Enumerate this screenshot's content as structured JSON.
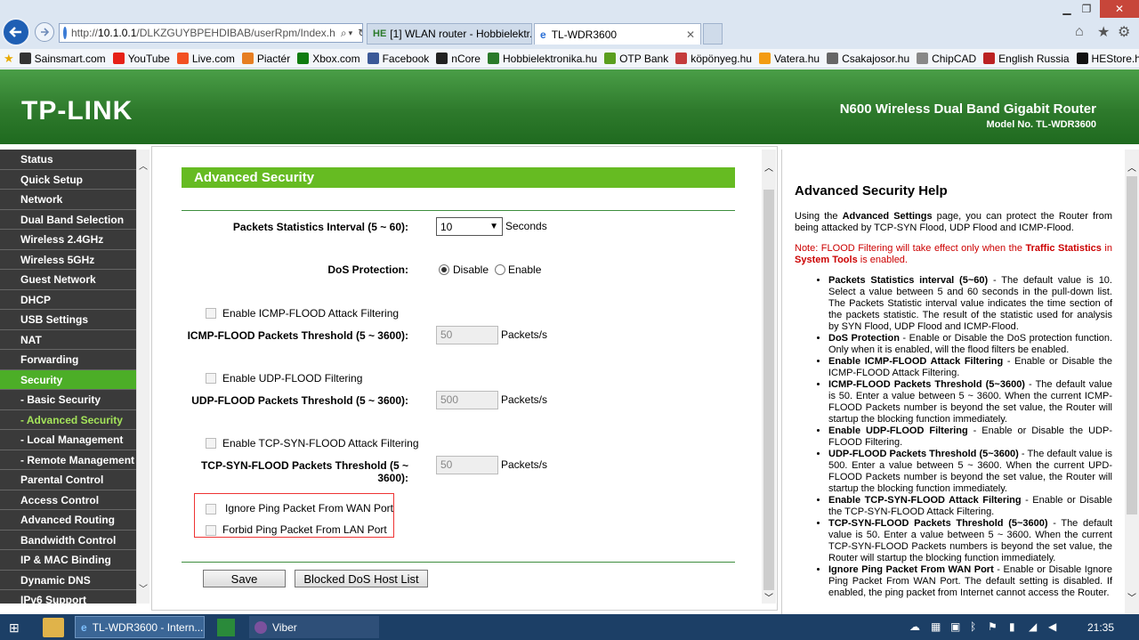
{
  "browser": {
    "address": {
      "prefix": "http://",
      "host": "10.1.0.1",
      "path": "/DLKZGUYBPEHDIBAB/userRpm/Index.h"
    },
    "tabs": [
      {
        "label": "[1] WLAN router - Hobbielektr...",
        "icon": "HE"
      },
      {
        "label": "TL-WDR3600",
        "icon": "e"
      }
    ],
    "favorites": [
      {
        "label": "Sainsmart.com",
        "color": "#333"
      },
      {
        "label": "YouTube",
        "color": "#e62117"
      },
      {
        "label": "Live.com",
        "color": "#f25022"
      },
      {
        "label": "Piactér",
        "color": "#e67e22"
      },
      {
        "label": "Xbox.com",
        "color": "#107c10"
      },
      {
        "label": "Facebook",
        "color": "#3b5998"
      },
      {
        "label": "nCore",
        "color": "#222"
      },
      {
        "label": "Hobbielektronika.hu",
        "color": "#2a7a2a"
      },
      {
        "label": "OTP Bank",
        "color": "#5a9e1e"
      },
      {
        "label": "köpönyeg.hu",
        "color": "#c43b3b"
      },
      {
        "label": "Vatera.hu",
        "color": "#f39c12"
      },
      {
        "label": "Csakajosor.hu",
        "color": "#666"
      },
      {
        "label": "ChipCAD",
        "color": "#888"
      },
      {
        "label": "English Russia",
        "color": "#b22"
      },
      {
        "label": "HEStore.hu",
        "color": "#111"
      }
    ]
  },
  "header": {
    "logo": "TP-LINK",
    "product": "N600 Wireless Dual Band Gigabit Router",
    "model": "Model No. TL-WDR3600"
  },
  "sidebar": {
    "items": [
      "Status",
      "Quick Setup",
      "Network",
      "Dual Band Selection",
      "Wireless 2.4GHz",
      "Wireless 5GHz",
      "Guest Network",
      "DHCP",
      "USB Settings",
      "NAT",
      "Forwarding",
      "Security",
      "- Basic Security",
      "- Advanced Security",
      "- Local Management",
      "- Remote Management",
      "Parental Control",
      "Access Control",
      "Advanced Routing",
      "Bandwidth Control",
      "IP & MAC Binding",
      "Dynamic DNS",
      "IPv6 Support"
    ]
  },
  "main": {
    "title": "Advanced Security",
    "interval_label": "Packets Statistics Interval (5 ~ 60):",
    "interval_value": "10",
    "seconds": "Seconds",
    "dos_label": "DoS Protection:",
    "disable": "Disable",
    "enable": "Enable",
    "icmp_filter": "Enable ICMP-FLOOD Attack Filtering",
    "icmp_threshold_label": "ICMP-FLOOD Packets Threshold (5 ~ 3600):",
    "icmp_threshold": "50",
    "udp_filter": "Enable UDP-FLOOD Filtering",
    "udp_threshold_label": "UDP-FLOOD Packets Threshold (5 ~ 3600):",
    "udp_threshold": "500",
    "tcp_filter": "Enable TCP-SYN-FLOOD Attack Filtering",
    "tcp_threshold_label": "TCP-SYN-FLOOD Packets Threshold (5 ~ 3600):",
    "tcp_threshold": "50",
    "unit": "Packets/s",
    "ignore_ping": "Ignore Ping Packet From WAN Port",
    "forbid_ping": "Forbid Ping Packet From LAN Port",
    "save": "Save",
    "blocked": "Blocked DoS Host List"
  },
  "help": {
    "title": "Advanced Security Help",
    "intro_a": "Using the ",
    "intro_b": "Advanced Settings",
    "intro_c": " page, you can protect the Router from being attacked by TCP-SYN Flood, UDP Flood and ICMP-Flood.",
    "note_a": "Note: FLOOD Filtering will take effect only when the ",
    "note_b": "Traffic Statistics",
    "note_c": " in ",
    "note_d": "System Tools",
    "note_e": " is enabled.",
    "items": [
      {
        "term": "Packets Statistics interval (5~60)",
        "desc": " - The default value is 10. Select a value between 5 and 60 seconds in the pull-down list. The Packets Statistic interval value indicates the time section of the packets statistic. The result of the statistic used for analysis by SYN Flood, UDP Flood and ICMP-Flood."
      },
      {
        "term": "DoS Protection",
        "desc": " - Enable or Disable the DoS protection function. Only when it is enabled, will the flood filters be enabled."
      },
      {
        "term": "Enable ICMP-FLOOD Attack Filtering",
        "desc": " - Enable or Disable the ICMP-FLOOD Attack Filtering."
      },
      {
        "term": "ICMP-FLOOD Packets Threshold (5~3600)",
        "desc": " - The default value is 50. Enter a value between 5 ~ 3600. When the current ICMP-FLOOD Packets number is beyond the set value, the Router will startup the blocking function immediately."
      },
      {
        "term": "Enable UDP-FLOOD Filtering",
        "desc": " - Enable or Disable the UDP-FLOOD Filtering."
      },
      {
        "term": "UDP-FLOOD Packets Threshold (5~3600)",
        "desc": " - The default value is 500. Enter a value between 5 ~ 3600. When the current UPD-FLOOD Packets number is beyond the set value, the Router will startup the blocking function immediately."
      },
      {
        "term": "Enable TCP-SYN-FLOOD Attack Filtering",
        "desc": " - Enable or Disable the TCP-SYN-FLOOD Attack Filtering."
      },
      {
        "term": "TCP-SYN-FLOOD Packets Threshold (5~3600)",
        "desc": " - The default value is 50. Enter a value between 5 ~ 3600. When the current TCP-SYN-FLOOD Packets numbers is beyond the set value, the Router will startup the blocking function immediately."
      },
      {
        "term": "Ignore Ping Packet From WAN Port",
        "desc": " - Enable or Disable Ignore Ping Packet From WAN Port. The default setting is disabled. If enabled, the ping packet from Internet cannot access the Router."
      }
    ]
  },
  "taskbar": {
    "ie": "TL-WDR3600 - Intern...",
    "viber": "Viber",
    "clock": "21:35"
  }
}
